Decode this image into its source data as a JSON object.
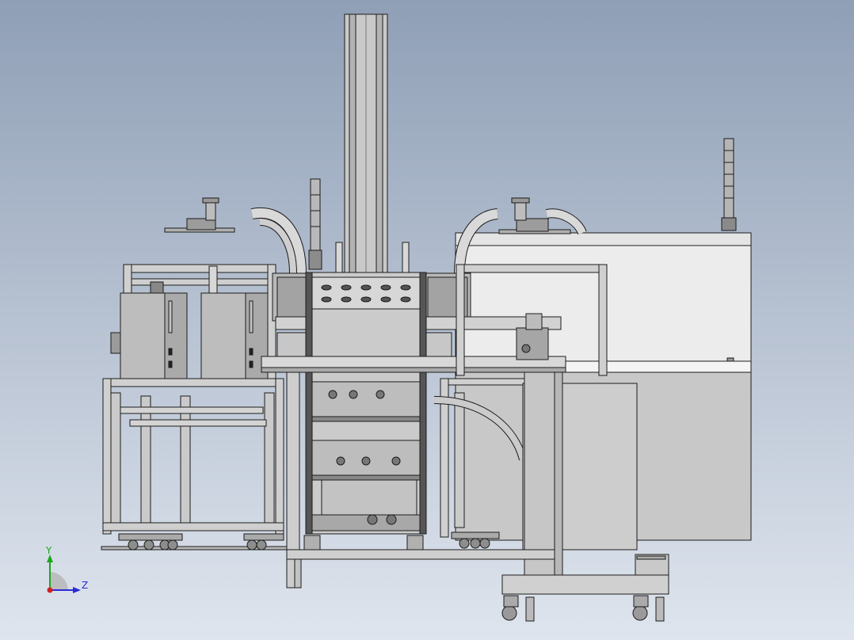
{
  "viewport": {
    "background_top": "#8f9fb6",
    "background_bottom": "#dfe5ee",
    "model_fill": "#c4c4c4",
    "model_fill_dark": "#a9a9a9",
    "model_fill_light": "#dadada",
    "panel_fill": "#e9e9e9",
    "edge_color": "#1c1c1c"
  },
  "triad": {
    "y_label": "Y",
    "z_label": "Z",
    "x_color": "#d42020",
    "y_color": "#1ba81b",
    "z_color": "#2b2bd6"
  }
}
